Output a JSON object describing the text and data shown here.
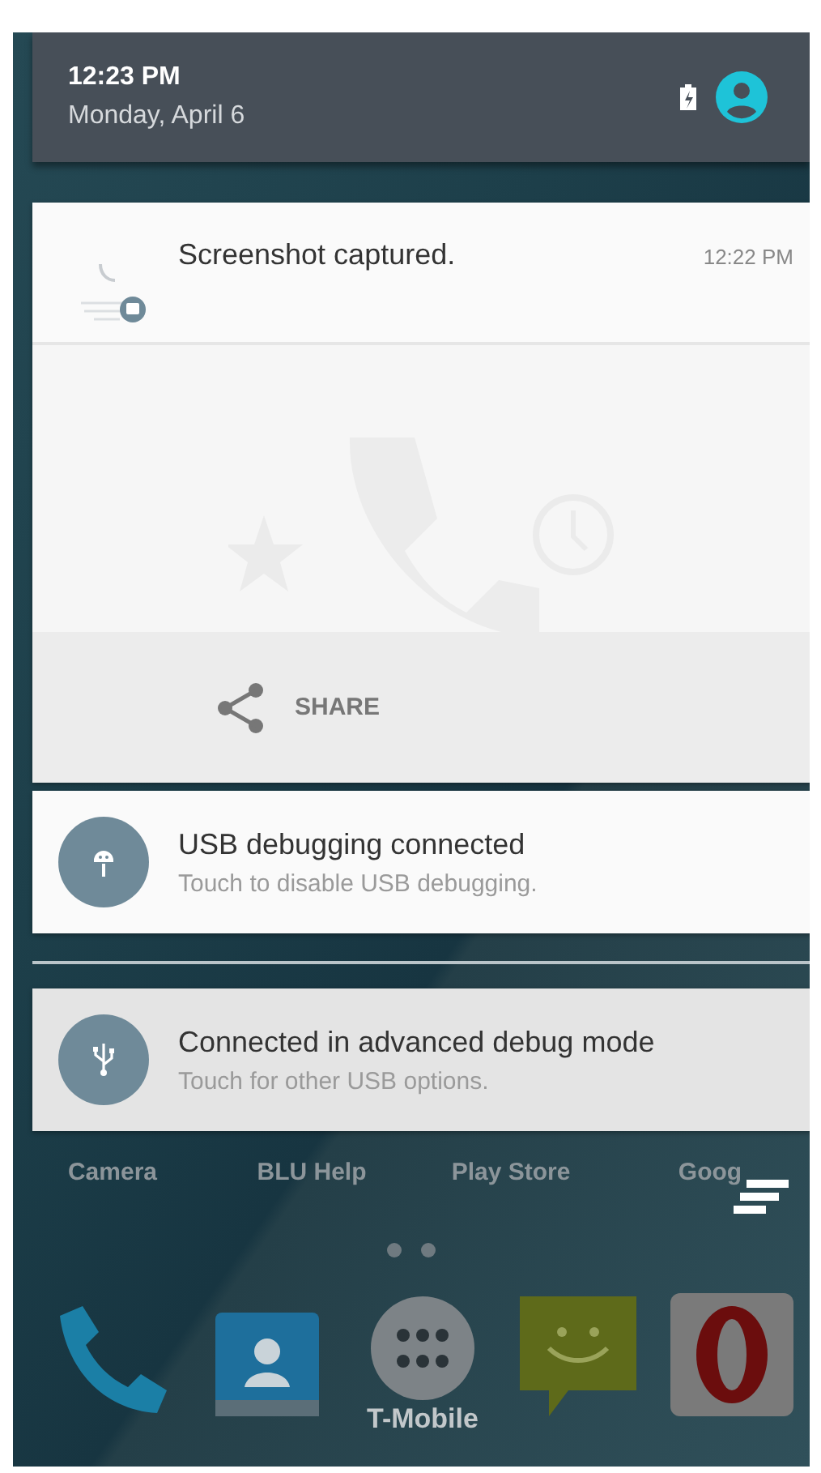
{
  "header": {
    "time": "12:23 PM",
    "date": "Monday, April 6"
  },
  "notifications": [
    {
      "kind": "screenshot",
      "title": "Screenshot captured.",
      "time": "12:22 PM",
      "action": "SHARE",
      "pressed": false
    },
    {
      "kind": "debugging",
      "title": "USB debugging connected",
      "text": "Touch to disable USB debugging.",
      "pressed": false
    },
    {
      "kind": "usb",
      "title": "Connected in advanced debug mode",
      "text": "Touch for other USB options.",
      "pressed": true
    }
  ],
  "home": {
    "apps": [
      {
        "label": "Camera"
      },
      {
        "label": "BLU Help"
      },
      {
        "label": "Play Store"
      },
      {
        "label": "Goog"
      }
    ],
    "dock": [
      {
        "kind": "phone"
      },
      {
        "kind": "contacts"
      },
      {
        "kind": "apps",
        "label": "T-Mobile"
      },
      {
        "kind": "messaging"
      },
      {
        "kind": "browser"
      }
    ]
  }
}
